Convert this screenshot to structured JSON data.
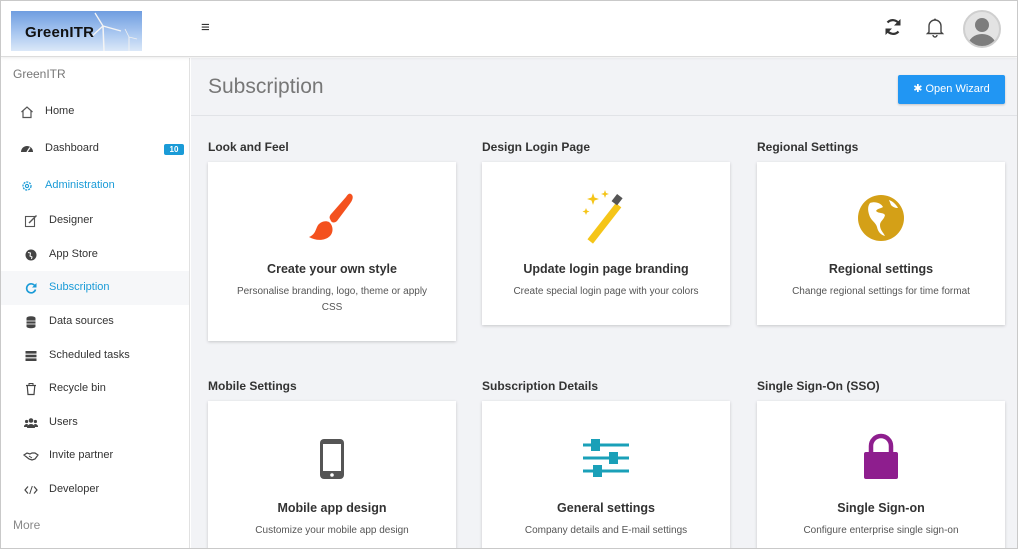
{
  "header": {
    "logo_text": "GreenITR",
    "icons": [
      "menu-icon",
      "refresh-icon",
      "bell-icon",
      "user-avatar"
    ]
  },
  "sidebar": {
    "brand": "GreenITR",
    "items": [
      {
        "label": "Home",
        "icon": "home-icon"
      },
      {
        "label": "Dashboard",
        "icon": "dashboard-icon",
        "badge": "10"
      },
      {
        "label": "Administration",
        "icon": "gear-icon"
      },
      {
        "label": "Designer",
        "icon": "edit-icon"
      },
      {
        "label": "App Store",
        "icon": "globe-icon"
      },
      {
        "label": "Subscription",
        "icon": "refresh-icon"
      },
      {
        "label": "Data sources",
        "icon": "database-icon"
      },
      {
        "label": "Scheduled tasks",
        "icon": "tasks-icon"
      },
      {
        "label": "Recycle bin",
        "icon": "trash-icon"
      },
      {
        "label": "Users",
        "icon": "users-icon"
      },
      {
        "label": "Invite partner",
        "icon": "handshake-icon"
      },
      {
        "label": "Developer",
        "icon": "code-icon"
      }
    ],
    "more": "More"
  },
  "main": {
    "title": "Subscription",
    "wizard_button": "Open Wizard",
    "sections": [
      {
        "heading": "Look and Feel",
        "card_title": "Create your own style",
        "card_desc": "Personalise branding, logo, theme or apply CSS",
        "icon": "paintbrush-icon"
      },
      {
        "heading": "Design Login Page",
        "card_title": "Update login page branding",
        "card_desc": "Create special login page with your colors",
        "icon": "magic-wand-icon"
      },
      {
        "heading": "Regional Settings",
        "card_title": "Regional settings",
        "card_desc": "Change regional settings for time format",
        "icon": "globe-americas-icon"
      },
      {
        "heading": "Mobile Settings",
        "card_title": "Mobile app design",
        "card_desc": "Customize your mobile app design",
        "icon": "mobile-icon"
      },
      {
        "heading": "Subscription Details",
        "card_title": "General settings",
        "card_desc": "Company details and E-mail settings",
        "icon": "sliders-icon"
      },
      {
        "heading": "Single Sign-On (SSO)",
        "card_title": "Single Sign-on",
        "card_desc": "Configure enterprise single sign-on",
        "icon": "lock-icon"
      }
    ]
  },
  "colors": {
    "accent": "#1a9bd7",
    "button": "#2196f3",
    "paintbrush": "#f4511e",
    "wand": "#f5c518",
    "globe": "#d4a017",
    "mobile": "#555555",
    "sliders": "#1aa0b8",
    "lock": "#8e1e8e"
  }
}
